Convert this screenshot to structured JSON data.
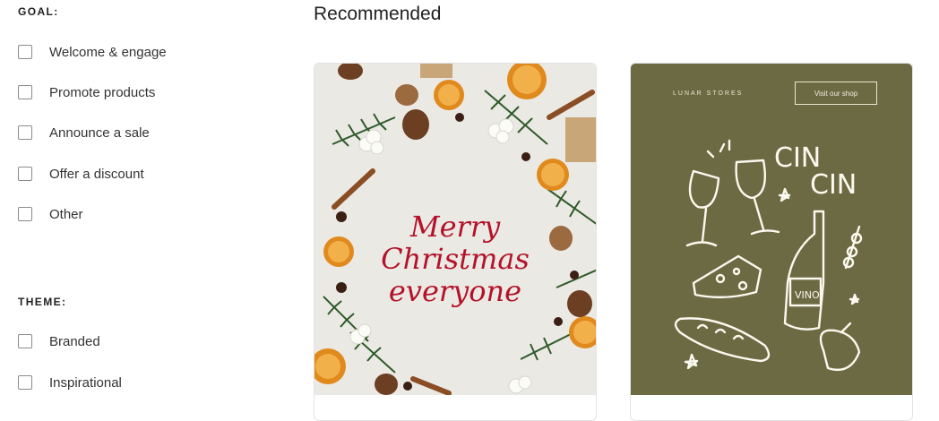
{
  "sidebar": {
    "goal_title": "GOAL:",
    "goal_items": [
      {
        "label": "Welcome & engage"
      },
      {
        "label": "Promote products"
      },
      {
        "label": "Announce a sale"
      },
      {
        "label": "Offer a discount"
      },
      {
        "label": "Other"
      }
    ],
    "theme_title": "THEME:",
    "theme_items": [
      {
        "label": "Branded"
      },
      {
        "label": "Inspirational"
      }
    ]
  },
  "main": {
    "heading": "Recommended",
    "cards": [
      {
        "text_line1": "Merry",
        "text_line2": "Christmas",
        "text_line3": "everyone"
      },
      {
        "brand": "LUNAR STORES",
        "button": "Visit our shop"
      }
    ]
  },
  "colors": {
    "christmas_red": "#b3122a",
    "olive_background": "#6b6a42",
    "light_background": "#ebe9e4"
  }
}
